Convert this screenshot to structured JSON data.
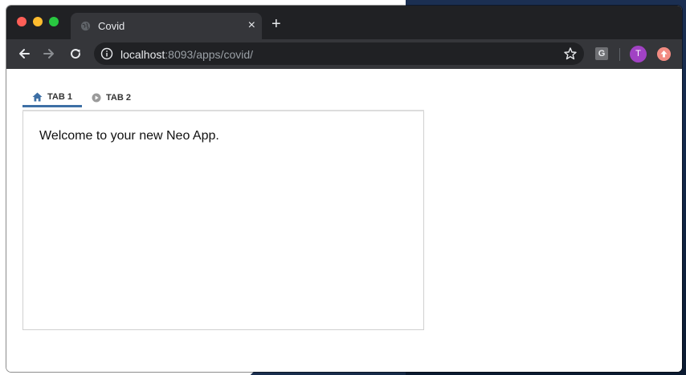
{
  "browser": {
    "tab_title": "Covid",
    "tab_close": "×",
    "new_tab": "+",
    "url_host": "localhost",
    "url_rest": ":8093/apps/covid/",
    "extension_label": "G",
    "avatar_letter": "T"
  },
  "app": {
    "tabs": [
      {
        "label": "TAB 1",
        "icon": "home-icon",
        "active": true
      },
      {
        "label": "TAB 2",
        "icon": "play-circle-icon",
        "active": false
      }
    ],
    "welcome_text": "Welcome to your new Neo App."
  },
  "colors": {
    "active_tab_accent": "#3d6fa5",
    "browser_frame": "#202124",
    "avatar": "#a142c4"
  }
}
